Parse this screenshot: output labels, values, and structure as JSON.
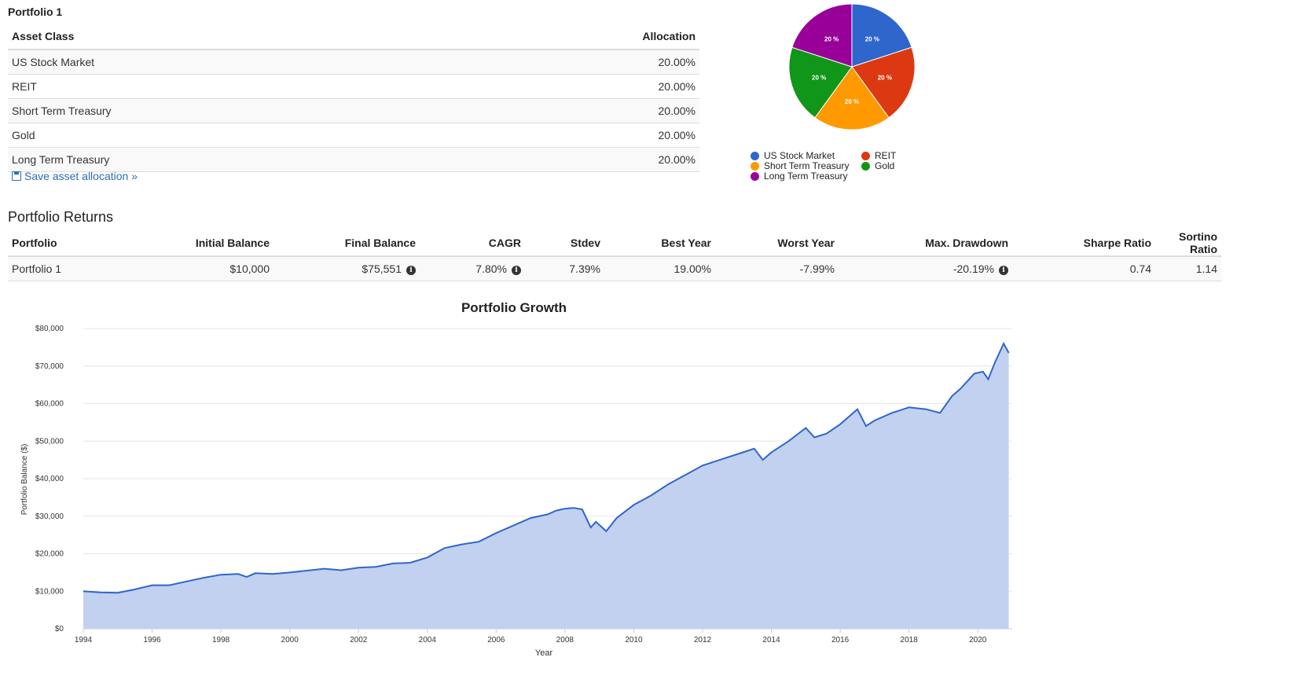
{
  "allocation": {
    "title": "Portfolio 1",
    "headers": {
      "asset_class": "Asset Class",
      "allocation": "Allocation"
    },
    "rows": [
      {
        "asset": "US Stock Market",
        "allocation": "20.00%"
      },
      {
        "asset": "REIT",
        "allocation": "20.00%"
      },
      {
        "asset": "Short Term Treasury",
        "allocation": "20.00%"
      },
      {
        "asset": "Gold",
        "allocation": "20.00%"
      },
      {
        "asset": "Long Term Treasury",
        "allocation": "20.00%"
      }
    ],
    "save_link": "Save asset allocation »"
  },
  "pie": {
    "slices": [
      {
        "name": "US Stock Market",
        "value": 20,
        "label": "20 %",
        "color": "#2f66cc"
      },
      {
        "name": "REIT",
        "value": 20,
        "label": "20 %",
        "color": "#dc3912"
      },
      {
        "name": "Short Term Treasury",
        "value": 20,
        "label": "20 %",
        "color": "#ff9900"
      },
      {
        "name": "Gold",
        "value": 20,
        "label": "20 %",
        "color": "#109618"
      },
      {
        "name": "Long Term Treasury",
        "value": 20,
        "label": "20 %",
        "color": "#990099"
      }
    ]
  },
  "returns": {
    "title": "Portfolio Returns",
    "headers": [
      "Portfolio",
      "Initial Balance",
      "Final Balance",
      "CAGR",
      "Stdev",
      "Best Year",
      "Worst Year",
      "Max. Drawdown",
      "Sharpe Ratio",
      "Sortino Ratio"
    ],
    "row": {
      "portfolio": "Portfolio 1",
      "initial_balance": "$10,000",
      "final_balance": "$75,551",
      "cagr": "7.80%",
      "stdev": "7.39%",
      "best_year": "19.00%",
      "worst_year": "-7.99%",
      "max_drawdown": "-20.19%",
      "sharpe": "0.74",
      "sortino": "1.14"
    },
    "info_icon": "info-circle-icon"
  },
  "chart_data": {
    "type": "area",
    "title": "Portfolio Growth",
    "xlabel": "Year",
    "ylabel": "Portfolio Balance ($)",
    "xlim": [
      1994,
      2021
    ],
    "ylim": [
      0,
      80000
    ],
    "x_ticks": [
      "1994",
      "1996",
      "1998",
      "2000",
      "2002",
      "2004",
      "2006",
      "2008",
      "2010",
      "2012",
      "2014",
      "2016",
      "2018",
      "2020"
    ],
    "y_ticks": [
      "$0",
      "$10,000",
      "$20,000",
      "$30,000",
      "$40,000",
      "$50,000",
      "$60,000",
      "$70,000",
      "$80,000"
    ],
    "grid": true,
    "line_color": "#2f66cc",
    "fill_color": "#c2d1ef",
    "series": [
      {
        "x": [
          1994.0,
          1994.5,
          1995.0,
          1995.5,
          1996.0,
          1996.5,
          1997.0,
          1997.5,
          1998.0,
          1998.5,
          1998.75,
          1999.0,
          1999.5,
          2000.0,
          2000.5,
          2001.0,
          2001.5,
          2002.0,
          2002.5,
          2003.0,
          2003.5,
          2004.0,
          2004.5,
          2005.0,
          2005.5,
          2006.0,
          2006.5,
          2007.0,
          2007.5,
          2007.75,
          2008.0,
          2008.25,
          2008.5,
          2008.75,
          2008.9,
          2009.2,
          2009.5,
          2010.0,
          2010.5,
          2011.0,
          2011.5,
          2012.0,
          2012.5,
          2013.0,
          2013.5,
          2013.75,
          2014.0,
          2014.5,
          2015.0,
          2015.25,
          2015.6,
          2016.0,
          2016.5,
          2016.75,
          2017.0,
          2017.5,
          2018.0,
          2018.5,
          2018.9,
          2019.25,
          2019.5,
          2019.9,
          2020.15,
          2020.3,
          2020.5,
          2020.75,
          2020.9
        ],
        "y": [
          10000,
          9700,
          9600,
          10500,
          11600,
          11600,
          12600,
          13600,
          14400,
          14600,
          13800,
          14800,
          14600,
          15000,
          15500,
          16000,
          15600,
          16300,
          16500,
          17400,
          17600,
          19000,
          21500,
          22500,
          23200,
          25500,
          27500,
          29500,
          30500,
          31500,
          32000,
          32200,
          31800,
          27000,
          28500,
          26000,
          29500,
          33000,
          35500,
          38500,
          41000,
          43500,
          45000,
          46500,
          48000,
          45000,
          47000,
          50000,
          53500,
          51000,
          52000,
          54500,
          58500,
          54000,
          55500,
          57500,
          59000,
          58500,
          57500,
          62000,
          64000,
          68000,
          68500,
          66500,
          71000,
          76000,
          73500
        ]
      }
    ]
  }
}
